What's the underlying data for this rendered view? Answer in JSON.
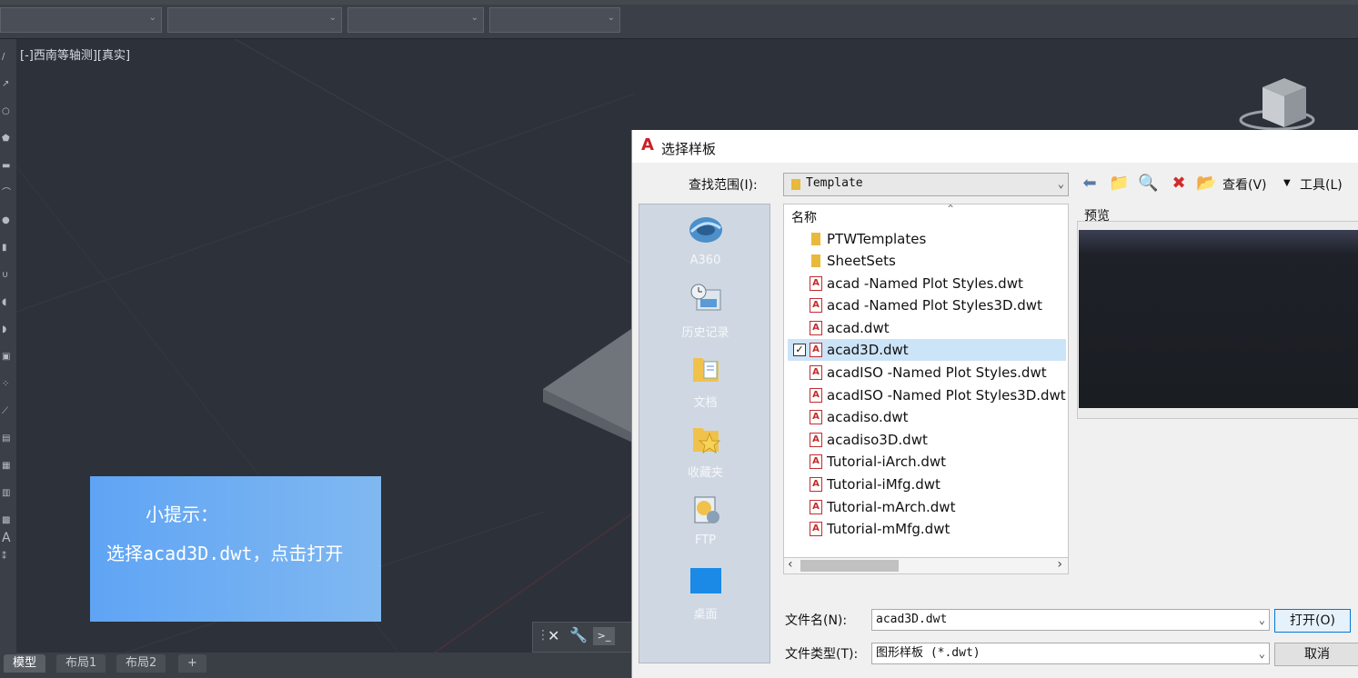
{
  "viewport": {
    "label": "[-]西南等轴测][真实]"
  },
  "tip": {
    "title": "小提示：",
    "body": "选择acad3D.dwt，点击打开"
  },
  "status_tabs": [
    {
      "label": "模型"
    },
    {
      "label": "布局1"
    },
    {
      "label": "布局2"
    },
    {
      "label": "+"
    }
  ],
  "dialog": {
    "title": "选择样板",
    "look_in_label": "查找范围(I):",
    "look_in_value": "Template",
    "toolbar": {
      "view_label": "查看(V)",
      "tools_label": "工具(L)"
    },
    "places": [
      {
        "label": "A360",
        "icon": "a360-icon"
      },
      {
        "label": "历史记录",
        "icon": "history-icon"
      },
      {
        "label": "文档",
        "icon": "documents-icon"
      },
      {
        "label": "收藏夹",
        "icon": "favorites-icon"
      },
      {
        "label": "FTP",
        "icon": "ftp-icon"
      },
      {
        "label": "桌面",
        "icon": "desktop-icon"
      }
    ],
    "column_name": "名称",
    "files": [
      {
        "name": "PTWTemplates",
        "type": "folder"
      },
      {
        "name": "SheetSets",
        "type": "folder"
      },
      {
        "name": "acad -Named Plot Styles.dwt",
        "type": "dwt"
      },
      {
        "name": "acad -Named Plot Styles3D.dwt",
        "type": "dwt"
      },
      {
        "name": "acad.dwt",
        "type": "dwt"
      },
      {
        "name": "acad3D.dwt",
        "type": "dwt",
        "selected": true
      },
      {
        "name": "acadISO -Named Plot Styles.dwt",
        "type": "dwt"
      },
      {
        "name": "acadISO -Named Plot Styles3D.dwt",
        "type": "dwt"
      },
      {
        "name": "acadiso.dwt",
        "type": "dwt"
      },
      {
        "name": "acadiso3D.dwt",
        "type": "dwt"
      },
      {
        "name": "Tutorial-iArch.dwt",
        "type": "dwt"
      },
      {
        "name": "Tutorial-iMfg.dwt",
        "type": "dwt"
      },
      {
        "name": "Tutorial-mArch.dwt",
        "type": "dwt"
      },
      {
        "name": "Tutorial-mMfg.dwt",
        "type": "dwt"
      }
    ],
    "preview_label": "预览",
    "filename_label": "文件名(N):",
    "filename_value": "acad3D.dwt",
    "filetype_label": "文件类型(T):",
    "filetype_value": "图形样板 (*.dwt)",
    "open_label": "打开(O)",
    "cancel_label": "取消"
  },
  "colors": {
    "tip_bg": "#6aaaf3",
    "selection": "#cce4f7",
    "viewport_bg": "#2d323a"
  }
}
